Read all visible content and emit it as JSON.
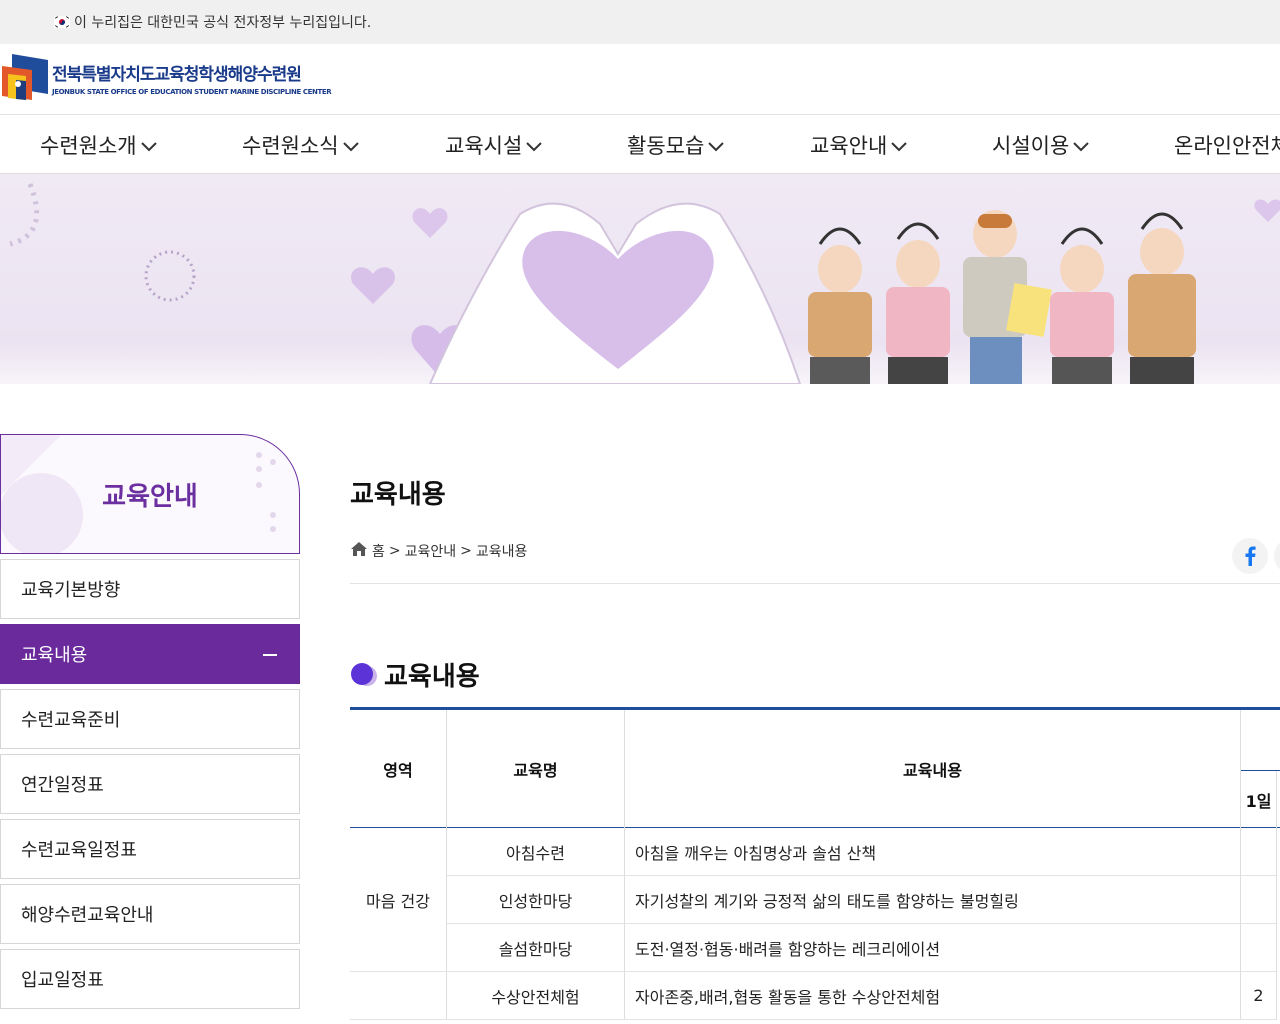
{
  "gov_banner": {
    "text": "이 누리집은 대한민국 공식 전자정부 누리집입니다."
  },
  "logo": {
    "title": "전북특별자치도교육청학생해양수련원",
    "subtitle": "JEONBUK STATE OFFICE  OF EDUCATION STUDENT MARINE DISCIPLINE CENTER"
  },
  "gnb": {
    "items": [
      {
        "label": "수련원소개"
      },
      {
        "label": "수련원소식"
      },
      {
        "label": "교육시설"
      },
      {
        "label": "활동모습"
      },
      {
        "label": "교육안내"
      },
      {
        "label": "시설이용"
      },
      {
        "label": "온라인안전체"
      }
    ]
  },
  "sidebar": {
    "title": "교육안내",
    "items": [
      {
        "label": "교육기본방향",
        "active": false
      },
      {
        "label": "교육내용",
        "active": true
      },
      {
        "label": "수련교육준비",
        "active": false
      },
      {
        "label": "연간일정표",
        "active": false
      },
      {
        "label": "수련교육일정표",
        "active": false
      },
      {
        "label": "해양수련교육안내",
        "active": false
      },
      {
        "label": "입교일정표",
        "active": false
      }
    ]
  },
  "page": {
    "title": "교육내용",
    "breadcrumb": [
      "홈",
      ">",
      "교육안내",
      ">",
      "교육내용"
    ],
    "section_title": "교육내용"
  },
  "table": {
    "headers": {
      "area": "영역",
      "name": "교육명",
      "content": "교육내용",
      "day1": "1일"
    },
    "rows": [
      {
        "area": "마음 건강",
        "name": "아침수련",
        "content": "아침을 깨우는 아침명상과 솔섬 산책",
        "day1": ""
      },
      {
        "area": "",
        "name": "인성한마당",
        "content": "자기성찰의 계기와 긍정적 삶의 태도를 함양하는 불멍힐링",
        "day1": ""
      },
      {
        "area": "",
        "name": "솔섬한마당",
        "content": "도전·열정·협동·배려를 함양하는 레크리에이션",
        "day1": ""
      },
      {
        "area": "",
        "name": "수상안전체험",
        "content": "자아존중,배려,협동 활동을 통한 수상안전체험",
        "day1": "2"
      }
    ]
  },
  "colors": {
    "brand_purple": "#6a2a9c",
    "table_blue": "#1e4e9c",
    "hero_bg": "#efe9f4"
  },
  "icons": [
    "korea-flag-icon",
    "chevron-down-icon",
    "home-icon",
    "facebook-icon",
    "minus-icon"
  ]
}
